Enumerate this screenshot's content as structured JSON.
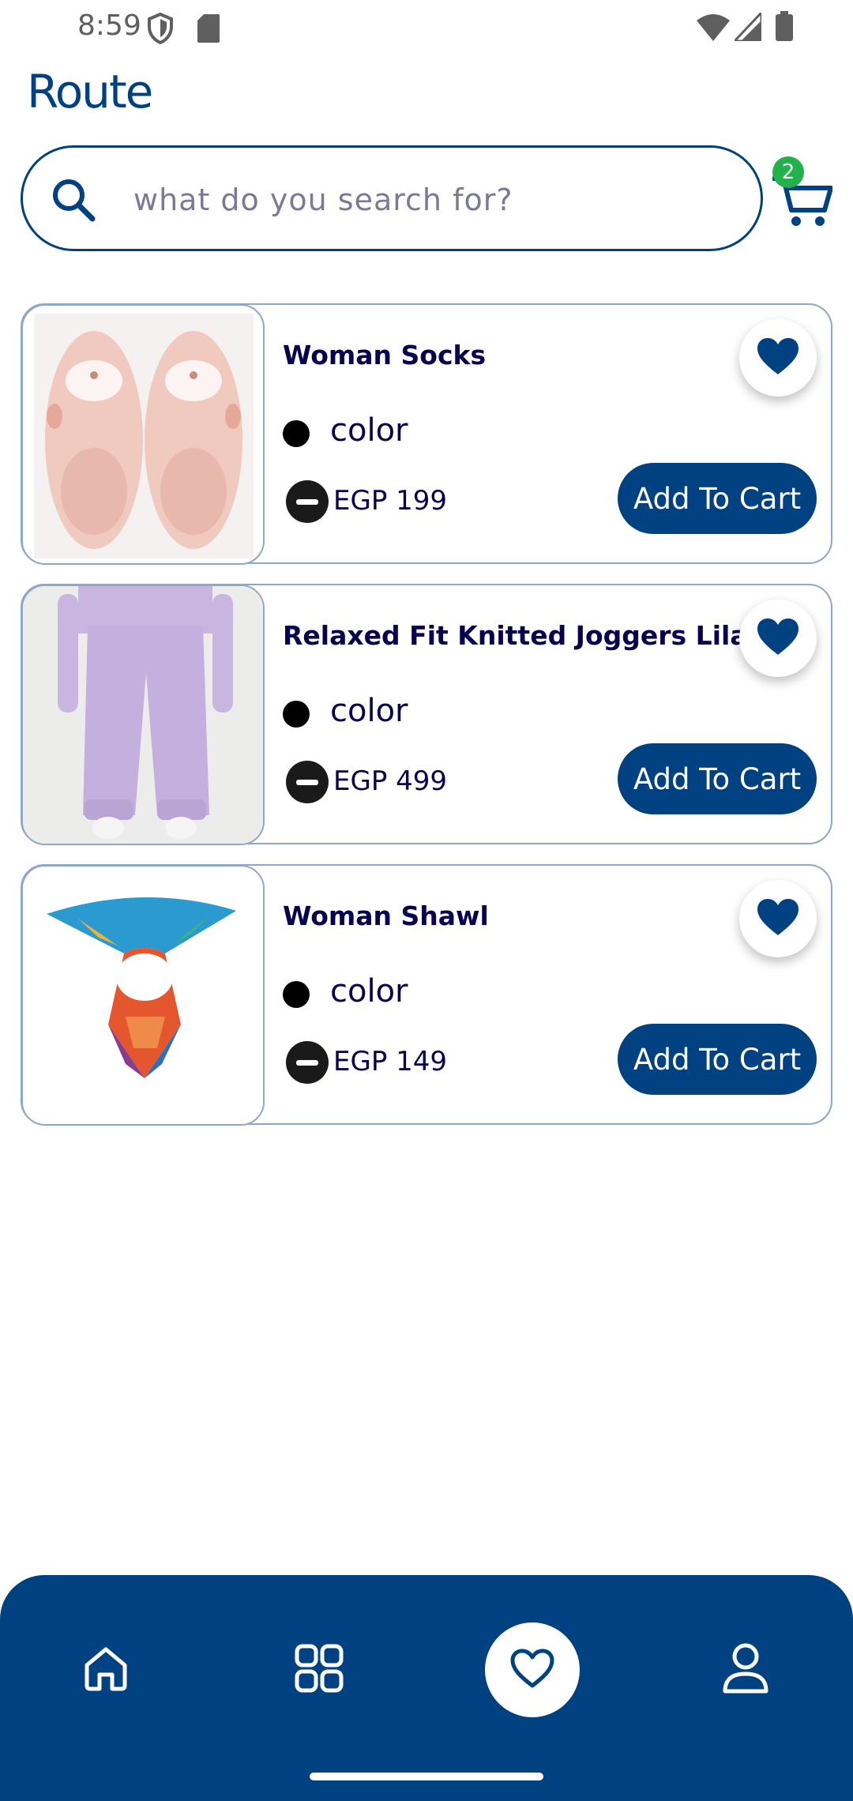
{
  "status_bar": {
    "time": "8:59",
    "icons": [
      "shield-icon",
      "sd-card-icon",
      "wifi-icon",
      "signal-icon",
      "battery-icon"
    ]
  },
  "header": {
    "logo_text": "Route",
    "search": {
      "placeholder": "what do you search for?",
      "value": ""
    },
    "cart": {
      "badge_count": "2",
      "icon": "cart-icon"
    }
  },
  "products": [
    {
      "title": "Woman Socks",
      "color_label": "color",
      "price": "EGP 199",
      "add_to_cart_label": "Add To Cart",
      "favorited": true
    },
    {
      "title": "Relaxed Fit Knitted Joggers Lilac",
      "color_label": "color",
      "price": "EGP 499",
      "add_to_cart_label": "Add To Cart",
      "favorited": true
    },
    {
      "title": "Woman Shawl",
      "color_label": "color",
      "price": "EGP 149",
      "add_to_cart_label": "Add To Cart",
      "favorited": true
    }
  ],
  "bottom_nav": {
    "items": [
      {
        "icon": "home-icon",
        "active": false
      },
      {
        "icon": "categories-grid-icon",
        "active": false
      },
      {
        "icon": "heart-icon",
        "active": true
      },
      {
        "icon": "profile-icon",
        "active": false
      }
    ]
  },
  "colors": {
    "primary": "#004182",
    "text_dark": "#06004F",
    "card_border": "#8fa8c8",
    "badge_green": "#22b14c"
  }
}
